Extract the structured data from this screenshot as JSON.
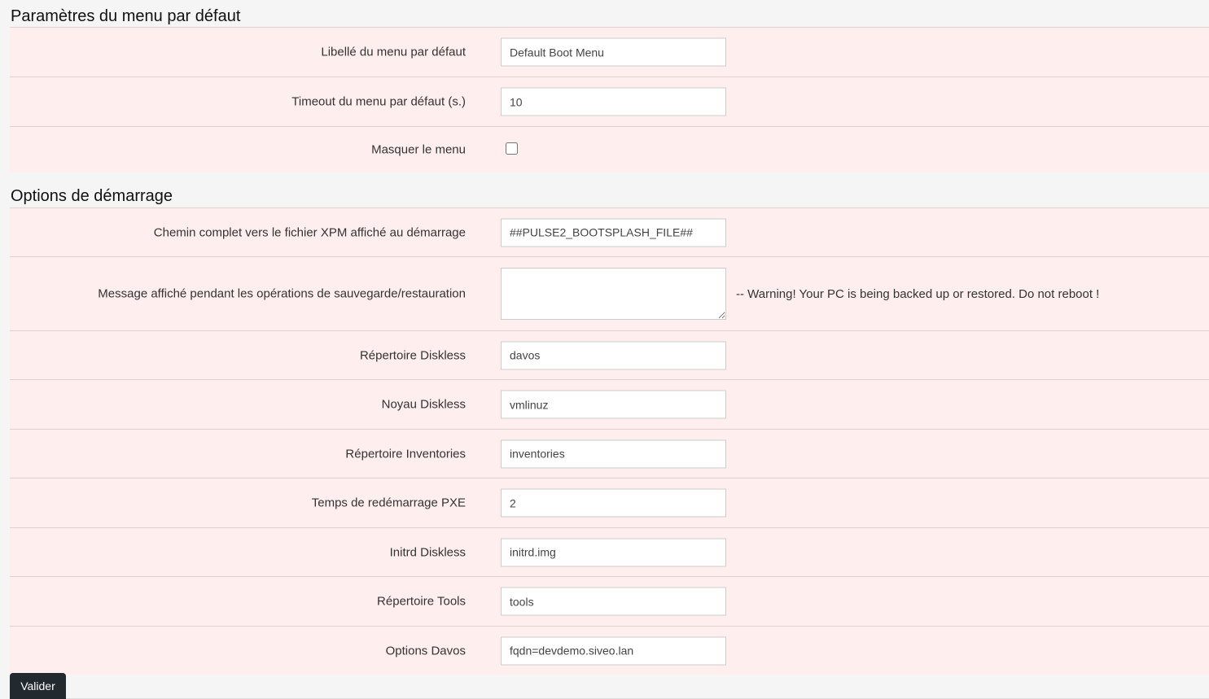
{
  "sections": {
    "default_menu": {
      "title": "Paramètres du menu par défaut",
      "menu_label": {
        "label": "Libellé du menu par défaut",
        "value": "Default Boot Menu"
      },
      "menu_timeout": {
        "label": "Timeout du menu par défaut (s.)",
        "value": "10"
      },
      "hide_menu": {
        "label": "Masquer le menu",
        "checked": false
      }
    },
    "boot_options": {
      "title": "Options de démarrage",
      "xpm_path": {
        "label": "Chemin complet vers le fichier XPM affiché au démarrage",
        "value": "##PULSE2_BOOTSPLASH_FILE##"
      },
      "backup_message": {
        "label": "Message affiché pendant les opérations de sauvegarde/restauration",
        "value": "",
        "hint": "-- Warning! Your PC is being backed up or restored. Do not reboot !"
      },
      "diskless_dir": {
        "label": "Répertoire Diskless",
        "value": "davos"
      },
      "diskless_kernel": {
        "label": "Noyau Diskless",
        "value": "vmlinuz"
      },
      "inventories_dir": {
        "label": "Répertoire Inventories",
        "value": "inventories"
      },
      "pxe_reboot_time": {
        "label": "Temps de redémarrage PXE",
        "value": "2"
      },
      "diskless_initrd": {
        "label": "Initrd Diskless",
        "value": "initrd.img"
      },
      "tools_dir": {
        "label": "Répertoire Tools",
        "value": "tools"
      },
      "davos_options": {
        "label": "Options Davos",
        "value": "fqdn=devdemo.siveo.lan"
      }
    }
  },
  "actions": {
    "submit_label": "Valider"
  },
  "colors": {
    "row_background": "#ffeeee",
    "page_background": "#f5f5f5",
    "button_background": "#222a30"
  }
}
